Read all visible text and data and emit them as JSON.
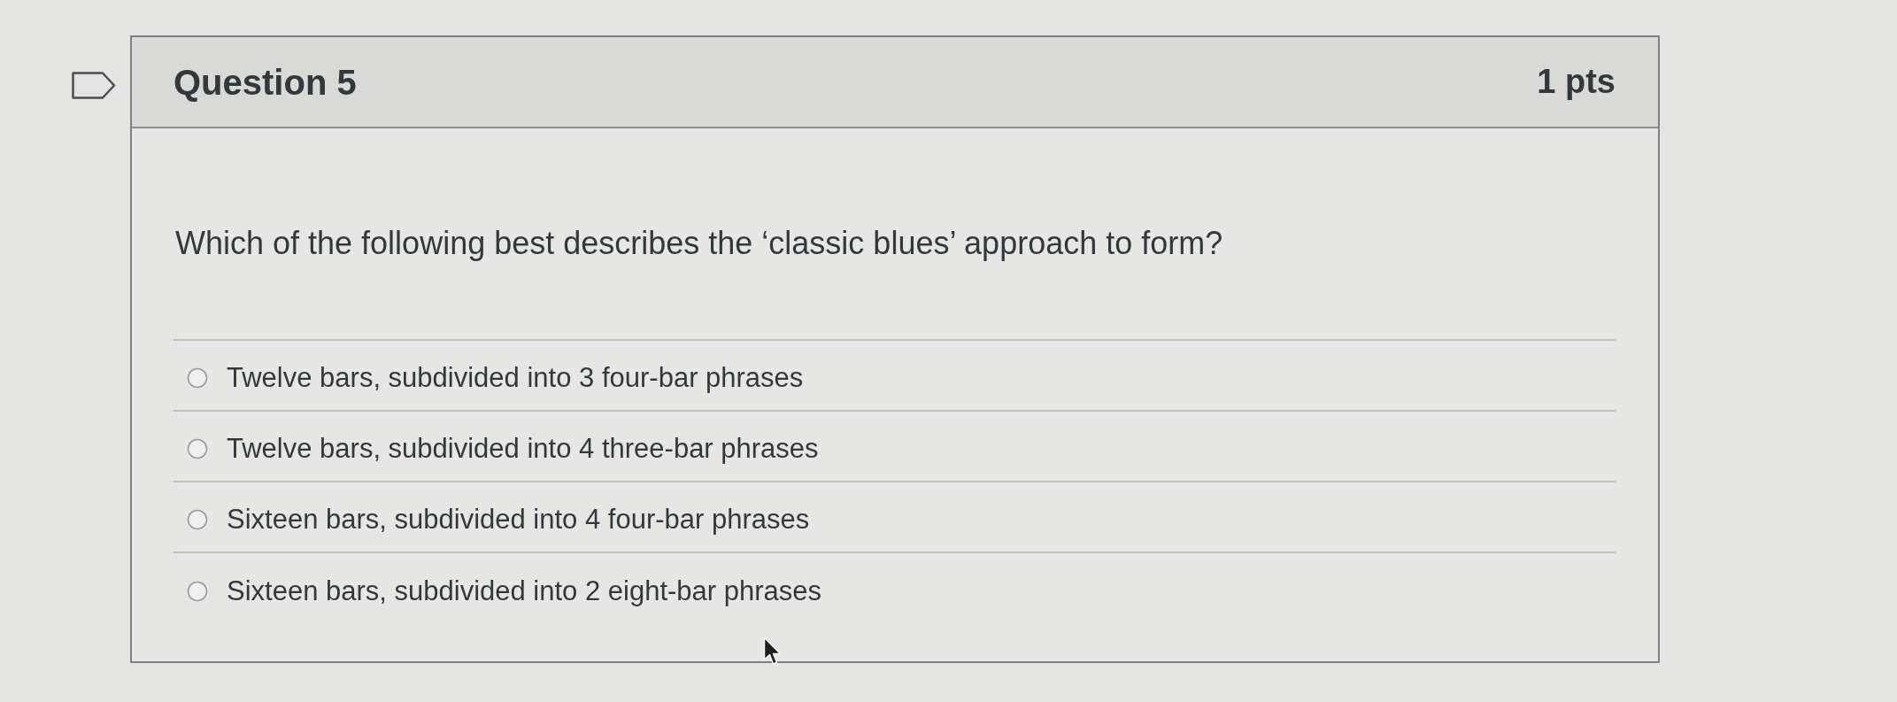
{
  "question": {
    "flagged": false,
    "title": "Question 5",
    "points": "1 pts",
    "text": "Which of the following best describes the ‘classic blues’ approach to form?",
    "answers": [
      {
        "label": "Twelve bars, subdivided into 3 four-bar phrases",
        "selected": false
      },
      {
        "label": "Twelve bars, subdivided into 4 three-bar phrases",
        "selected": false
      },
      {
        "label": "Sixteen bars, subdivided into 4 four-bar phrases",
        "selected": false
      },
      {
        "label": "Sixteen bars, subdivided into 2 eight-bar phrases",
        "selected": false
      }
    ]
  }
}
